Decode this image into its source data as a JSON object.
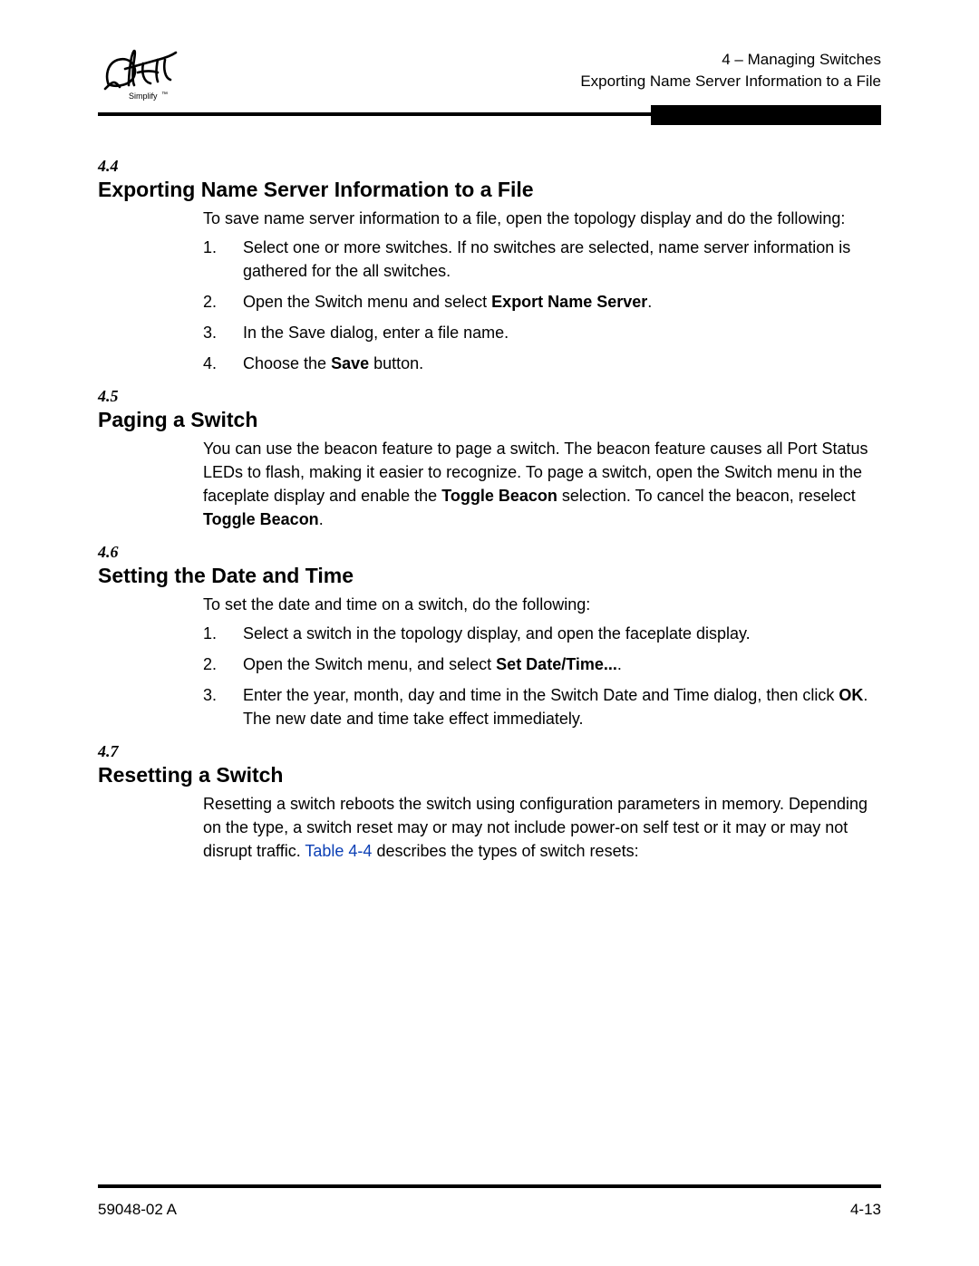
{
  "header": {
    "logo_alt": "qlogic Simplify",
    "line1": "4 – Managing Switches",
    "line2": "Exporting Name Server Information to a File"
  },
  "sections": {
    "s44": {
      "num": "4.4",
      "title": "Exporting Name Server Information to a File",
      "intro": "To save name server information to a file, open the topology display and do the following:",
      "steps": {
        "s1": "Select one or more switches. If no switches are selected, name server information is gathered for the all switches.",
        "s2_pre": "Open the Switch menu and select ",
        "s2_bold": "Export Name Server",
        "s2_post": ".",
        "s3": "In the Save dialog, enter a file name.",
        "s4_pre": "Choose the ",
        "s4_bold": "Save",
        "s4_post": " button."
      }
    },
    "s45": {
      "num": "4.5",
      "title": "Paging a Switch",
      "para_1": "You can use the beacon feature to page a switch. The beacon feature causes all Port Status LEDs to flash, making it easier to recognize. To page a switch, open the Switch menu in the faceplate display and enable the ",
      "para_bold1": "Toggle Beacon",
      "para_2": " selection. To cancel the beacon, reselect ",
      "para_bold2": "Toggle Beacon",
      "para_3": "."
    },
    "s46": {
      "num": "4.6",
      "title": "Setting the Date and Time",
      "intro": "To set the date and time on a switch, do the following:",
      "steps": {
        "s1": "Select a switch in the topology display, and open the faceplate display.",
        "s2_pre": "Open the Switch menu, and select ",
        "s2_bold": "Set Date/Time...",
        "s2_post": ".",
        "s3_pre": "Enter the year, month, day and time in the Switch Date and Time dialog, then click ",
        "s3_bold": "OK",
        "s3_post": ". The new date and time take effect immediately."
      }
    },
    "s47": {
      "num": "4.7",
      "title": "Resetting a Switch",
      "para_pre": "Resetting a switch reboots the switch using configuration parameters in memory. Depending on the type, a switch reset may or may not include power-on self test or it may or may not disrupt traffic. ",
      "para_link": "Table 4-4",
      "para_post": " describes the types of switch resets:"
    }
  },
  "footer": {
    "left": "59048-02 A",
    "right": "4-13"
  },
  "numbers": {
    "n1": "1.",
    "n2": "2.",
    "n3": "3.",
    "n4": "4."
  }
}
